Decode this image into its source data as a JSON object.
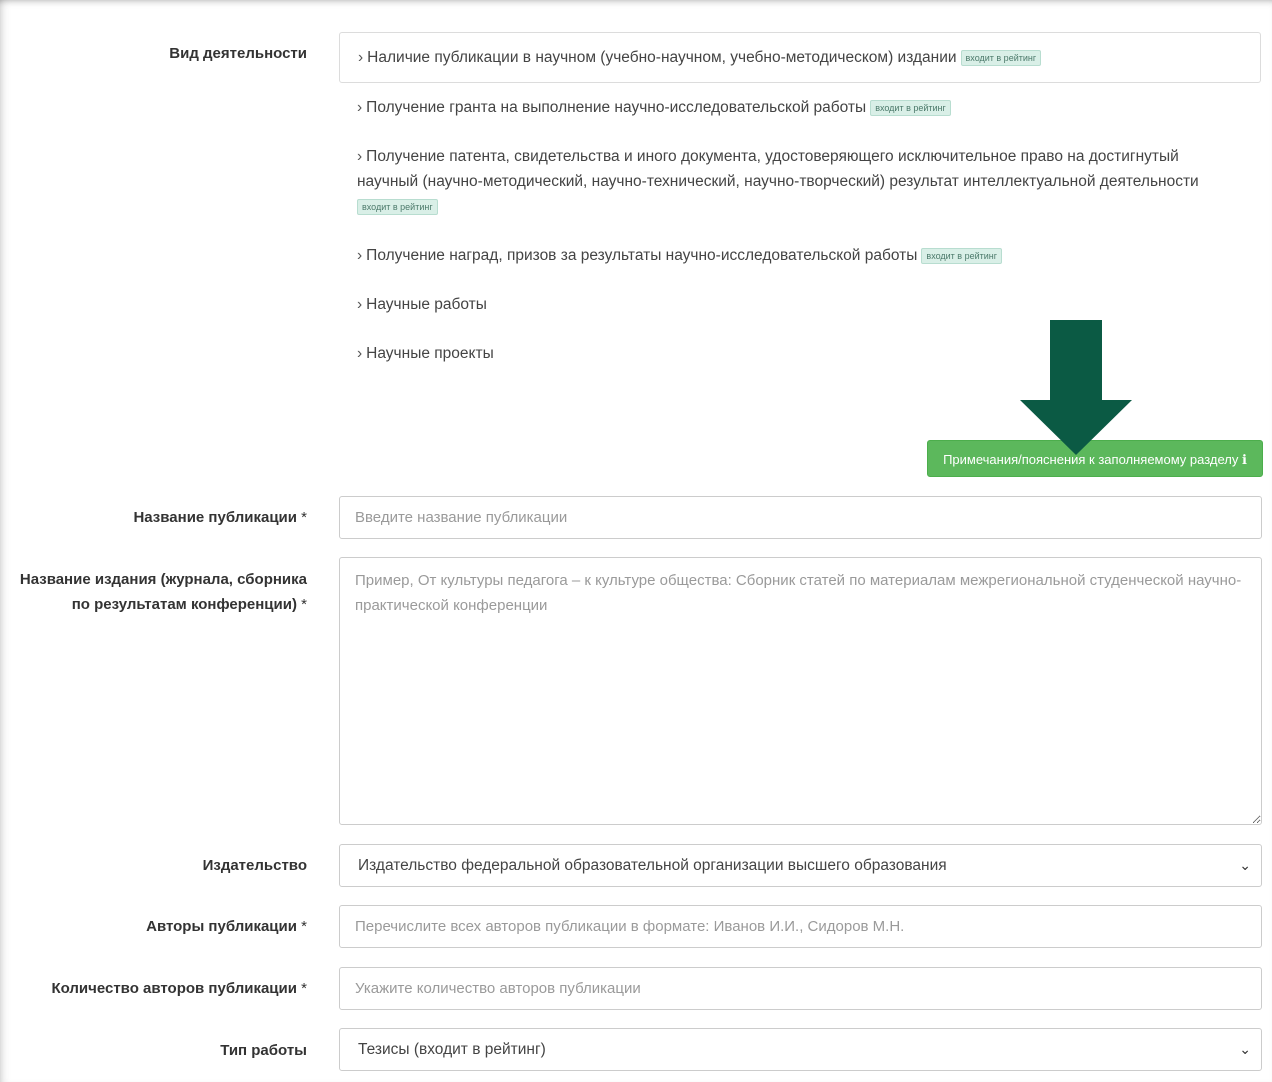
{
  "form": {
    "activity_label": "Вид деятельности",
    "activities": [
      {
        "text": "Наличие публикации в научном (учебно-научном, учебно-методическом) издании",
        "badge": "входит в рейтинг"
      },
      {
        "text": "Получение гранта на выполнение научно-исследовательской работы",
        "badge": "входит в рейтинг"
      },
      {
        "text": "Получение патента, свидетельства и иного документа, удостоверяющего исключительное право на достигнутый научный (научно-методический, научно-технический, научно-творческий) результат интеллектуальной деятельности",
        "badge": "входит в рейтинг"
      },
      {
        "text": "Получение наград, призов за результаты научно-исследовательской работы",
        "badge": "входит в рейтинг"
      },
      {
        "text": "Научные работы",
        "badge": ""
      },
      {
        "text": "Научные проекты",
        "badge": ""
      }
    ],
    "note_button": "Примечания/пояснения к заполняемому разделу ℹ",
    "publication_title": {
      "label": "Название публикации",
      "required": "*",
      "placeholder": "Введите название публикации"
    },
    "edition_title": {
      "label": "Название издания (журнала, сборника по результатам конференции)",
      "required": "*",
      "placeholder": "Пример, От культуры педагога – к культуре общества: Сборник статей по материалам межрегиональной студенческой научно-практической конференции"
    },
    "publisher": {
      "label": "Издательство",
      "value": "Издательство федеральной образовательной организации высшего образования"
    },
    "authors": {
      "label": "Авторы публикации",
      "required": "*",
      "placeholder": "Перечислите всех авторов публикации в формате: Иванов И.И., Сидоров М.Н."
    },
    "authors_count": {
      "label": "Количество авторов публикации",
      "required": "*",
      "placeholder": "Укажите количество авторов публикации"
    },
    "work_type": {
      "label": "Тип работы",
      "value": "Тезисы (входит в рейтинг)"
    }
  },
  "colors": {
    "note_button": "#5cb85c",
    "arrow": "#0b5a44",
    "badge_bg": "#d9efe7"
  }
}
